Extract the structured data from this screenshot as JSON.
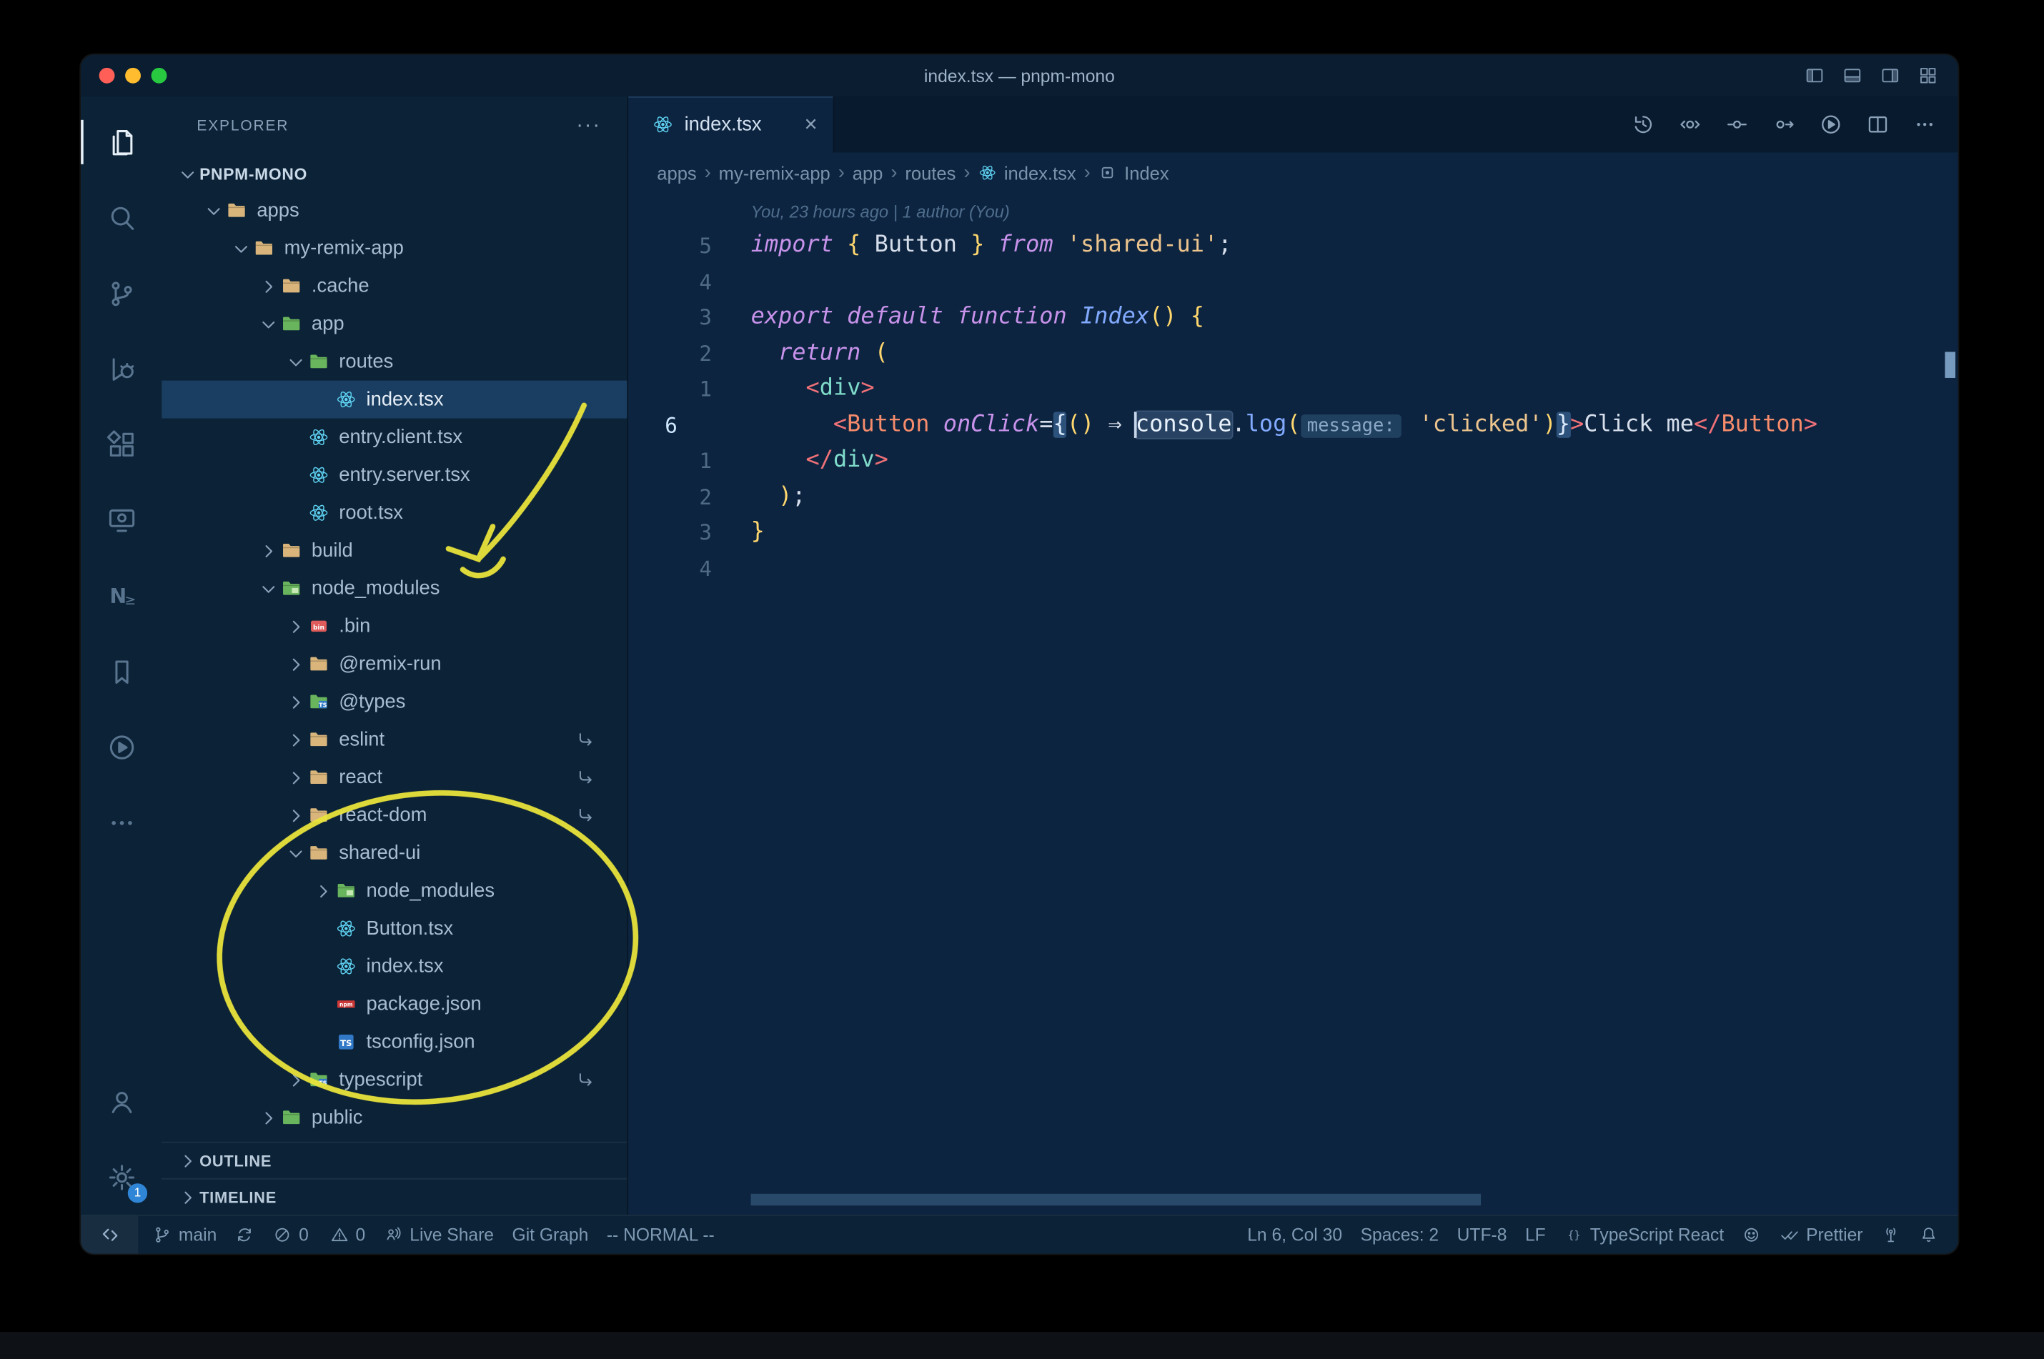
{
  "window": {
    "title": "index.tsx — pnpm-mono",
    "traffic_lights": [
      {
        "name": "close",
        "color": "#ff5f57"
      },
      {
        "name": "minimize",
        "color": "#febc2e"
      },
      {
        "name": "zoom",
        "color": "#28c840"
      }
    ],
    "titlebar_icons": [
      "layout-sidebar-left",
      "layout-panel",
      "layout-sidebar-right",
      "layout-customize"
    ]
  },
  "activity_bar": {
    "top": [
      {
        "name": "explorer",
        "icon": "files",
        "active": true
      },
      {
        "name": "search",
        "icon": "search"
      },
      {
        "name": "source-control",
        "icon": "source-control"
      },
      {
        "name": "run-debug",
        "icon": "run-debug"
      },
      {
        "name": "extensions",
        "icon": "extensions"
      },
      {
        "name": "remote-explorer",
        "icon": "remote-monitor"
      },
      {
        "name": "nx-console",
        "icon": "nx"
      },
      {
        "name": "bookmarks",
        "icon": "bookmark"
      },
      {
        "name": "code-runner",
        "icon": "run-circle"
      },
      {
        "name": "more-views",
        "icon": "more"
      }
    ],
    "bottom": [
      {
        "name": "account",
        "icon": "account"
      },
      {
        "name": "settings",
        "icon": "gear",
        "badge": "1"
      }
    ]
  },
  "sidebar": {
    "header": "EXPLORER",
    "more_label": "···",
    "root": "PNPM-MONO",
    "tree": [
      {
        "label": "apps",
        "depth": 0,
        "kind": "folder",
        "icon": "folder-tan",
        "state": "expanded"
      },
      {
        "label": "my-remix-app",
        "depth": 1,
        "kind": "folder",
        "icon": "folder-tan",
        "state": "expanded"
      },
      {
        "label": ".cache",
        "depth": 2,
        "kind": "folder",
        "icon": "folder-tan",
        "state": "collapsed"
      },
      {
        "label": "app",
        "depth": 2,
        "kind": "folder",
        "icon": "folder-green",
        "state": "expanded"
      },
      {
        "label": "routes",
        "depth": 3,
        "kind": "folder",
        "icon": "folder-green",
        "state": "expanded"
      },
      {
        "label": "index.tsx",
        "depth": 4,
        "kind": "file",
        "icon": "react",
        "selected": true
      },
      {
        "label": "entry.client.tsx",
        "depth": 3,
        "kind": "file",
        "icon": "react"
      },
      {
        "label": "entry.server.tsx",
        "depth": 3,
        "kind": "file",
        "icon": "react"
      },
      {
        "label": "root.tsx",
        "depth": 3,
        "kind": "file",
        "icon": "react"
      },
      {
        "label": "build",
        "depth": 2,
        "kind": "folder",
        "icon": "folder-tan",
        "state": "collapsed"
      },
      {
        "label": "node_modules",
        "depth": 2,
        "kind": "folder",
        "icon": "folder-npm",
        "state": "expanded"
      },
      {
        "label": ".bin",
        "depth": 3,
        "kind": "folder",
        "icon": "bin",
        "state": "collapsed"
      },
      {
        "label": "@remix-run",
        "depth": 3,
        "kind": "folder",
        "icon": "folder-tan",
        "state": "collapsed"
      },
      {
        "label": "@types",
        "depth": 3,
        "kind": "folder",
        "icon": "folder-ts",
        "state": "collapsed"
      },
      {
        "label": "eslint",
        "depth": 3,
        "kind": "folder",
        "icon": "folder-tan",
        "state": "collapsed",
        "symlink": true
      },
      {
        "label": "react",
        "depth": 3,
        "kind": "folder",
        "icon": "folder-tan",
        "state": "collapsed",
        "symlink": true
      },
      {
        "label": "react-dom",
        "depth": 3,
        "kind": "folder",
        "icon": "folder-tan",
        "state": "collapsed",
        "symlink": true
      },
      {
        "label": "shared-ui",
        "depth": 3,
        "kind": "folder",
        "icon": "folder-tan",
        "state": "expanded"
      },
      {
        "label": "node_modules",
        "depth": 4,
        "kind": "folder",
        "icon": "folder-npm",
        "state": "collapsed"
      },
      {
        "label": "Button.tsx",
        "depth": 4,
        "kind": "file",
        "icon": "react"
      },
      {
        "label": "index.tsx",
        "depth": 4,
        "kind": "file",
        "icon": "react"
      },
      {
        "label": "package.json",
        "depth": 4,
        "kind": "file",
        "icon": "npm"
      },
      {
        "label": "tsconfig.json",
        "depth": 4,
        "kind": "file",
        "icon": "ts"
      },
      {
        "label": "typescript",
        "depth": 3,
        "kind": "folder",
        "icon": "folder-ts",
        "state": "collapsed",
        "symlink": true
      },
      {
        "label": "public",
        "depth": 2,
        "kind": "folder",
        "icon": "folder-green",
        "state": "collapsed"
      }
    ],
    "sections": [
      "OUTLINE",
      "TIMELINE"
    ]
  },
  "editor": {
    "tab": {
      "label": "index.tsx",
      "icon": "react",
      "close": "×"
    },
    "actions": [
      "history",
      "peek",
      "inline",
      "jump",
      "run-circle",
      "split-editor",
      "more"
    ],
    "breadcrumbs": [
      {
        "label": "apps"
      },
      {
        "label": "my-remix-app"
      },
      {
        "label": "app"
      },
      {
        "label": "routes"
      },
      {
        "label": "index.tsx",
        "icon": "react"
      },
      {
        "label": "Index",
        "icon": "symbol"
      }
    ],
    "blame": "You, 23 hours ago | 1 author (You)",
    "code": {
      "lines": [
        {
          "num": "5",
          "tokens": [
            [
              "import",
              "kw"
            ],
            [
              " ",
              "pl"
            ],
            [
              "{",
              "br"
            ],
            [
              " ",
              "pl"
            ],
            [
              "Button",
              "pl"
            ],
            [
              " ",
              "pl"
            ],
            [
              "}",
              "br"
            ],
            [
              " ",
              "pl"
            ],
            [
              "from",
              "kw"
            ],
            [
              " ",
              "pl"
            ],
            [
              "'shared-ui'",
              "str"
            ],
            [
              ";",
              "pl"
            ]
          ]
        },
        {
          "num": "4",
          "tokens": []
        },
        {
          "num": "3",
          "tokens": [
            [
              "export",
              "kw"
            ],
            [
              " ",
              "pl"
            ],
            [
              "default",
              "kw"
            ],
            [
              " ",
              "pl"
            ],
            [
              "function",
              "kw"
            ],
            [
              " ",
              "pl"
            ],
            [
              "Index",
              "fni"
            ],
            [
              "(",
              "br"
            ],
            [
              ")",
              "br"
            ],
            [
              " ",
              "pl"
            ],
            [
              "{",
              "br"
            ]
          ]
        },
        {
          "num": "2",
          "tokens": [
            [
              "  ",
              "pl"
            ],
            [
              "return",
              "kw"
            ],
            [
              " ",
              "pl"
            ],
            [
              "(",
              "br"
            ]
          ]
        },
        {
          "num": "1",
          "tokens": [
            [
              "    ",
              "pl"
            ],
            [
              "<",
              "tagp"
            ],
            [
              "div",
              "div"
            ],
            [
              ">",
              "tagp"
            ]
          ]
        },
        {
          "num": "6",
          "active": true,
          "tokens": [
            [
              "      ",
              "pl"
            ],
            [
              "<",
              "tagp"
            ],
            [
              "Button",
              "comp"
            ],
            [
              " ",
              "pl"
            ],
            [
              "onClick",
              "attr"
            ],
            [
              "=",
              "pl"
            ],
            [
              "{",
              "brhl"
            ],
            [
              "(",
              "br"
            ],
            [
              ")",
              "br"
            ],
            [
              " ",
              "pl"
            ],
            [
              "⇒",
              "pl"
            ],
            [
              " ",
              "pl"
            ],
            [
              "",
              "cursor"
            ],
            [
              "console",
              "hlword"
            ],
            [
              ".",
              "pl"
            ],
            [
              "log",
              "fn"
            ],
            [
              "(",
              "br"
            ],
            [
              "message:",
              "inlay"
            ],
            [
              " ",
              "pl"
            ],
            [
              "'clicked'",
              "str"
            ],
            [
              ")",
              "br"
            ],
            [
              "}",
              "brhl"
            ],
            [
              ">",
              "tagp"
            ],
            [
              "Click me",
              "pl"
            ],
            [
              "</",
              "tagp"
            ],
            [
              "Button",
              "comp"
            ],
            [
              ">",
              "tagp"
            ]
          ]
        },
        {
          "num": "1",
          "tokens": [
            [
              "    ",
              "pl"
            ],
            [
              "</",
              "tagp"
            ],
            [
              "div",
              "div"
            ],
            [
              ">",
              "tagp"
            ]
          ]
        },
        {
          "num": "2",
          "tokens": [
            [
              "  ",
              "pl"
            ],
            [
              ")",
              "br"
            ],
            [
              ";",
              "pl"
            ]
          ]
        },
        {
          "num": "3",
          "tokens": [
            [
              "}",
              "br"
            ]
          ]
        },
        {
          "num": "4",
          "tokens": []
        }
      ]
    }
  },
  "status_bar": {
    "left": [
      {
        "name": "remote-indicator",
        "icon": "remote"
      },
      {
        "name": "git-branch",
        "icon": "branch",
        "label": "main"
      },
      {
        "name": "sync",
        "icon": "sync"
      },
      {
        "name": "problems",
        "icon": "error",
        "label": "0",
        "icon2": "warning",
        "label2": "0"
      },
      {
        "name": "live-share",
        "icon": "live-share",
        "label": "Live Share"
      },
      {
        "name": "git-graph",
        "label": "Git Graph"
      },
      {
        "name": "vim-mode",
        "label": "-- NORMAL --"
      }
    ],
    "right": [
      {
        "name": "cursor-position",
        "label": "Ln 6, Col 30"
      },
      {
        "name": "indentation",
        "label": "Spaces: 2"
      },
      {
        "name": "encoding",
        "label": "UTF-8"
      },
      {
        "name": "eol",
        "label": "LF"
      },
      {
        "name": "language-mode",
        "icon": "braces",
        "label": "TypeScript React"
      },
      {
        "name": "feedback",
        "icon": "smiley"
      },
      {
        "name": "prettier",
        "icon": "double-check",
        "label": "Prettier"
      },
      {
        "name": "live-reload",
        "icon": "radio-tower"
      },
      {
        "name": "notifications",
        "icon": "bell"
      }
    ]
  },
  "annotations": {
    "color": "#e9e43c"
  }
}
